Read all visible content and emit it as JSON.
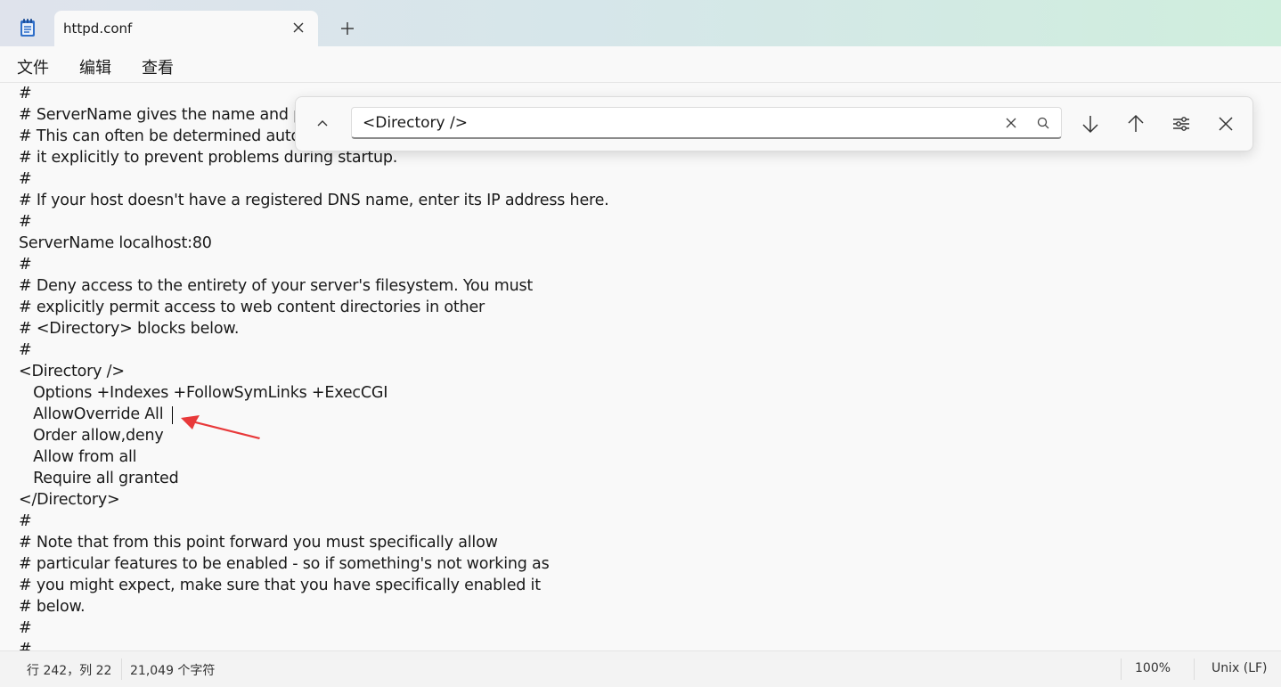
{
  "tab": {
    "title": "httpd.conf"
  },
  "menu": {
    "file": "文件",
    "edit": "编辑",
    "view": "查看"
  },
  "find": {
    "query": "<Directory />"
  },
  "editor": {
    "lines": [
      "#",
      "# ServerName gives the name and p",
      "# This can often be determined auto",
      "# it explicitly to prevent problems during startup.",
      "#",
      "# If your host doesn't have a registered DNS name, enter its IP address here.",
      "#",
      "ServerName localhost:80",
      "#",
      "# Deny access to the entirety of your server's filesystem. You must",
      "# explicitly permit access to web content directories in other",
      "# <Directory> blocks below.",
      "#",
      "<Directory />",
      "   Options +Indexes +FollowSymLinks +ExecCGI",
      "   AllowOverride All",
      "   Order allow,deny",
      "   Allow from all",
      "   Require all granted",
      "</Directory>",
      "#",
      "# Note that from this point forward you must specifically allow",
      "# particular features to be enabled - so if something's not working as",
      "# you might expect, make sure that you have specifically enabled it",
      "# below.",
      "#",
      "#"
    ]
  },
  "status": {
    "position": "行 242，列 22",
    "chars": "21,049 个字符",
    "zoom": "100%",
    "line_ending": "Unix (LF)"
  },
  "colors": {
    "annotation_arrow": "#e8393a",
    "title_gradient_end": "#cfeedd"
  }
}
